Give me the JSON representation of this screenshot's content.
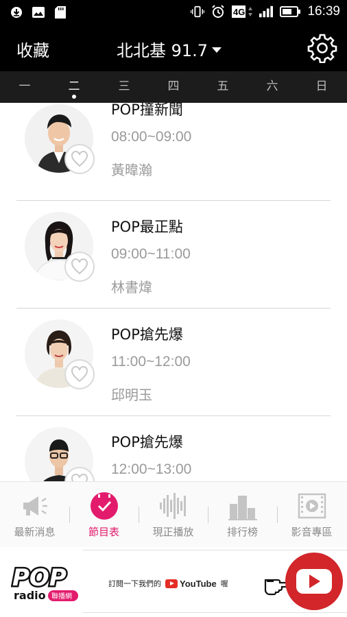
{
  "status_bar": {
    "time": "16:39",
    "network": "4G",
    "icons_left": [
      "download-icon",
      "image-icon",
      "sd-card-icon"
    ],
    "icons_right": [
      "vibrate-icon",
      "alarm-icon",
      "network-4g-icon",
      "signal-icon",
      "battery-icon"
    ]
  },
  "header": {
    "favorites_label": "收藏",
    "station_label": "北北基 91.7",
    "settings_icon": "gear-icon"
  },
  "day_tabs": [
    {
      "label": "一",
      "active": false
    },
    {
      "label": "二",
      "active": true
    },
    {
      "label": "三",
      "active": false
    },
    {
      "label": "四",
      "active": false
    },
    {
      "label": "五",
      "active": false
    },
    {
      "label": "六",
      "active": false
    },
    {
      "label": "日",
      "active": false
    }
  ],
  "programs": [
    {
      "title": "POP撞新聞",
      "time": "08:00~09:00",
      "host": "黃暐瀚"
    },
    {
      "title": "POP最正點",
      "time": "09:00~11:00",
      "host": "林書煒"
    },
    {
      "title": "POP搶先爆",
      "time": "11:00~12:00",
      "host": "邱明玉"
    },
    {
      "title": "POP搶先爆",
      "time": "12:00~13:00",
      "host": ""
    }
  ],
  "bottom_nav": [
    {
      "label": "最新消息",
      "icon": "megaphone-icon",
      "active": false
    },
    {
      "label": "節目表",
      "icon": "schedule-check-icon",
      "active": true
    },
    {
      "label": "現正播放",
      "icon": "soundwave-icon",
      "active": false
    },
    {
      "label": "排行榜",
      "icon": "ranking-icon",
      "active": false
    },
    {
      "label": "影音專區",
      "icon": "video-icon",
      "active": false
    }
  ],
  "ad_banner": {
    "logo_text": "POP",
    "logo_sub": "radio",
    "logo_tag": "聯播網",
    "text_before": "訂閱一下我們的",
    "youtube_word": "YouTube",
    "text_after": "喔"
  },
  "colors": {
    "header_bg": "#000000",
    "daytabs_bg": "#1c1c1c",
    "accent": "#e31b6d",
    "youtube_red": "#e52d27"
  }
}
